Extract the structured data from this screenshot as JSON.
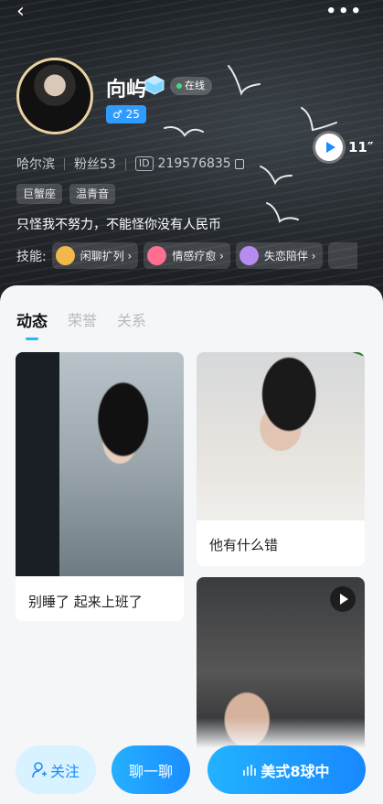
{
  "header": {
    "back_icon": "‹",
    "more_icon": "•••",
    "name": "向屿",
    "online": "在线",
    "gender_age": "♂ 25",
    "voice_length": "11″",
    "city": "哈尔滨",
    "fans": "粉丝53",
    "id_label": "ID",
    "id_value": "219576835",
    "tags": [
      "巨蟹座",
      "温青音"
    ],
    "bio": "只怪我不努力，不能怪你没有人民币",
    "skills_label": "技能:",
    "skills": [
      {
        "label": "闲聊扩列 ›",
        "color": "#f2b84b"
      },
      {
        "label": "情感疗愈 ›",
        "color": "#ff6f8f"
      },
      {
        "label": "失恋陪伴 ›",
        "color": "#b68cf0"
      }
    ]
  },
  "tabs": [
    {
      "label": "动态",
      "active": true
    },
    {
      "label": "荣誉",
      "active": false
    },
    {
      "label": "关系",
      "active": false
    }
  ],
  "posts": [
    {
      "caption": "别睡了 起来上班了"
    },
    {
      "caption": "他有什么错"
    },
    {
      "caption": ""
    }
  ],
  "actions": {
    "follow": "关注",
    "chat": "聊一聊",
    "voice_room": "美式8球中"
  },
  "colors": {
    "accent": "#1c8bff",
    "online_dot": "#3fdc7a"
  }
}
